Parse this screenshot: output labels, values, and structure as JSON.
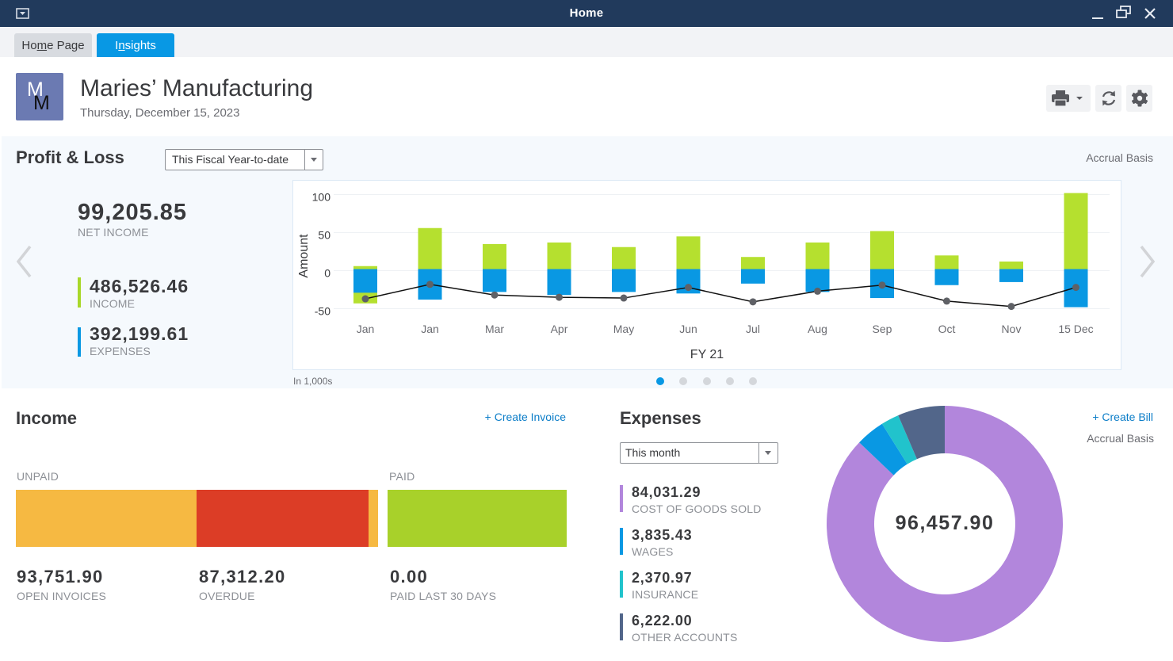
{
  "window": {
    "title": "Home",
    "menu_icon": "window-menu-icon",
    "controls": [
      "minimize-icon",
      "restore-icon",
      "close-icon"
    ]
  },
  "tabs": [
    {
      "pre": "Ho",
      "key": "m",
      "post": "e Page",
      "active": false
    },
    {
      "pre": "I",
      "key": "n",
      "post": "sights",
      "active": true
    }
  ],
  "company": {
    "initial_top": "M",
    "initial_bottom": "M",
    "name": "Maries’ Manufacturing",
    "date": "Thursday, December 15, 2023"
  },
  "toolbar": {
    "icons": [
      "printer-icon",
      "refresh-icon",
      "gear-icon"
    ]
  },
  "profit_loss": {
    "title": "Profit & Loss",
    "period": "This Fiscal Year-to-date",
    "basis": "Accrual Basis",
    "net_income": {
      "value": "99,205.85",
      "label": "NET INCOME"
    },
    "income": {
      "value": "486,526.46",
      "label": "INCOME",
      "color": "#a8d82a"
    },
    "expenses": {
      "value": "392,199.61",
      "label": "EXPENSES",
      "color": "#0998e3"
    },
    "units_note": "In 1,000s",
    "pagination": {
      "pages": 5,
      "current": 1
    }
  },
  "income_panel": {
    "title": "Income",
    "create_link": "+ Create Invoice",
    "unpaid_label": "UNPAID",
    "paid_label": "PAID",
    "unpaid_segments": [
      {
        "name": "open",
        "fraction": 0.499,
        "color": "#f6b942"
      },
      {
        "name": "overdue",
        "fraction": 0.475,
        "color": "#dc3d26"
      },
      {
        "name": "open-remainder",
        "fraction": 0.026,
        "color": "#f6b942"
      }
    ],
    "paid_color": "#a8d12a",
    "open_invoices": {
      "value": "93,751.90",
      "label": "OPEN INVOICES"
    },
    "overdue": {
      "value": "87,312.20",
      "label": "OVERDUE"
    },
    "paid_last_30": {
      "value": "0.00",
      "label": "PAID LAST 30 DAYS"
    }
  },
  "expenses_panel": {
    "title": "Expenses",
    "period": "This month",
    "create_link": "+ Create Bill",
    "basis": "Accrual Basis",
    "total": "96,457.90",
    "items": [
      {
        "value": "84,031.29",
        "label": "COST OF GOODS SOLD",
        "color": "#b286dc"
      },
      {
        "value": "3,835.43",
        "label": "WAGES",
        "color": "#0998e3"
      },
      {
        "value": "2,370.97",
        "label": "INSURANCE",
        "color": "#21c3cc"
      },
      {
        "value": "6,222.00",
        "label": "OTHER ACCOUNTS",
        "color": "#52668a"
      }
    ]
  },
  "chart_data": [
    {
      "type": "bar",
      "title": "Profit & Loss",
      "xlabel": "FY 21",
      "ylabel": "Amount",
      "units": "In 1,000s",
      "ylim": [
        -50,
        100
      ],
      "y_ticks": [
        100,
        50,
        0,
        -50
      ],
      "grid": true,
      "categories": [
        "Jan",
        "Jan",
        "Mar",
        "Apr",
        "May",
        "Jun",
        "Jul",
        "Aug",
        "Sep",
        "Oct",
        "Nov",
        "15 Dec"
      ],
      "series": [
        {
          "name": "Income",
          "type": "bar",
          "color": "#b5e02f",
          "values": [
            6,
            56,
            35,
            37,
            31,
            45,
            18,
            37,
            52,
            20,
            12,
            102
          ],
          "low_values": [
            -43,
            0,
            0,
            0,
            0,
            0,
            0,
            0,
            0,
            0,
            0,
            0
          ]
        },
        {
          "name": "Expenses",
          "type": "bar",
          "color": "#0998e3",
          "values": [
            -29,
            -38,
            -28,
            -32,
            -28,
            -30,
            -17,
            -28,
            -36,
            -19,
            -15,
            -48
          ]
        },
        {
          "name": "Net",
          "type": "line",
          "color": "#111111",
          "marker_color": "#5f6166",
          "values": [
            -37,
            -18,
            -32,
            -35,
            -36,
            -22,
            -41,
            -27,
            -19,
            -40,
            -47,
            -22
          ]
        }
      ]
    },
    {
      "type": "pie",
      "title": "Expenses",
      "donut": true,
      "center_label": "96,457.90",
      "labels": [
        "COST OF GOODS SOLD",
        "WAGES",
        "INSURANCE",
        "OTHER ACCOUNTS"
      ],
      "values": [
        84031.29,
        3835.43,
        2370.97,
        6222.0
      ],
      "colors": [
        "#b286dc",
        "#0998e3",
        "#21c3cc",
        "#52668a"
      ],
      "start": "top",
      "direction": "clockwise"
    }
  ]
}
